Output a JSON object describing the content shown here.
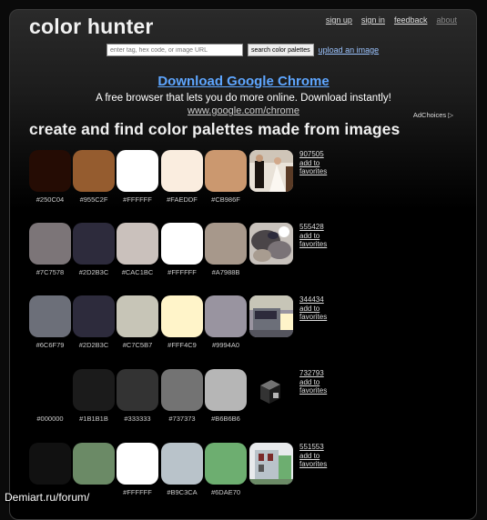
{
  "header": {
    "logo": "color hunter",
    "nav": [
      "sign up",
      "sign in",
      "feedback",
      "about"
    ]
  },
  "search": {
    "placeholder": "enter tag, hex code, or image URL",
    "button": "search color palettes",
    "upload": "upload an image"
  },
  "ad": {
    "title": "Download Google Chrome",
    "text": "A free browser that lets you do more online. Download instantly!",
    "url": "www.google.com/chrome",
    "adchoices": "AdChoices ▷"
  },
  "heading": "create and find color palettes made from images",
  "palettes": [
    {
      "id": "907505",
      "fav": "add to favorites",
      "colors": [
        "#250C04",
        "#955C2F",
        "#FFFFFF",
        "#FAEDDF",
        "#CB986F"
      ],
      "labels": [
        "#250C04",
        "#955C2F",
        "#FFFFFF",
        "#FAEDDF",
        "#CB986F"
      ],
      "thumb": "wedding-photo"
    },
    {
      "id": "555428",
      "fav": "add to favorites",
      "colors": [
        "#7C7578",
        "#2D2B3C",
        "#CAC1BC",
        "#FFFFFF",
        "#A7988B"
      ],
      "labels": [
        "#7C7578",
        "#2D2B3C",
        "#CAC1BC",
        "#FFFFFF",
        "#A7988B"
      ],
      "thumb": "rocks-photo"
    },
    {
      "id": "344434",
      "fav": "add to favorites",
      "colors": [
        "#6C6F79",
        "#2D2B3C",
        "#C7C5B7",
        "#FFF4C9",
        "#9994A0"
      ],
      "labels": [
        "#6C6F79",
        "#2D2B3C",
        "#C7C5B7",
        "#FFF4C9",
        "#9994A0"
      ],
      "thumb": "street-photo"
    },
    {
      "id": "732793",
      "fav": "add to favorites",
      "colors": [
        "#000000",
        "#1B1B1B",
        "#333333",
        "#737373",
        "#B6B6B6"
      ],
      "labels": [
        "#000000",
        "#1B1B1B",
        "#333333",
        "#737373",
        "#B6B6B6"
      ],
      "thumb": "cube-photo"
    },
    {
      "id": "551553",
      "fav": "add to favorites",
      "colors": [
        "#111111",
        "#6B8A66",
        "#FFFFFF",
        "#B9C3CA",
        "#6DAE70"
      ],
      "labels": [
        "",
        "",
        "#FFFFFF",
        "#B9C3CA",
        "#6DAE70"
      ],
      "thumb": "building-photo"
    }
  ],
  "watermark": "Demiart.ru/forum/"
}
